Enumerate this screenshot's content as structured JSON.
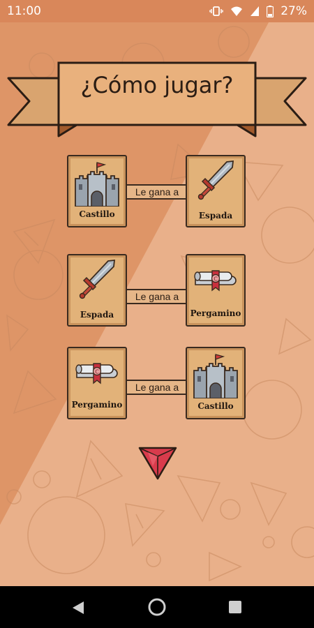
{
  "status": {
    "time": "11:00",
    "battery_pct": "27%"
  },
  "page": {
    "title": "¿Cómo jugar?"
  },
  "rules": [
    {
      "winner": "Castillo",
      "winner_icon": "castle-icon",
      "relation": "Le gana a",
      "loser": "Espada",
      "loser_icon": "sword-icon"
    },
    {
      "winner": "Espada",
      "winner_icon": "sword-icon",
      "relation": "Le gana a",
      "loser": "Pergamino",
      "loser_icon": "scroll-icon"
    },
    {
      "winner": "Pergamino",
      "winner_icon": "scroll-icon",
      "relation": "Le gana a",
      "loser": "Castillo",
      "loser_icon": "castle-icon"
    }
  ],
  "nav": {
    "icons": [
      "back-icon",
      "home-icon",
      "recents-icon"
    ]
  },
  "colors": {
    "background": "#E3A47E",
    "banner": "#E9B17D",
    "card": "#E2B279",
    "gem": "#D93B4C",
    "accent_red": "#C9303E"
  }
}
